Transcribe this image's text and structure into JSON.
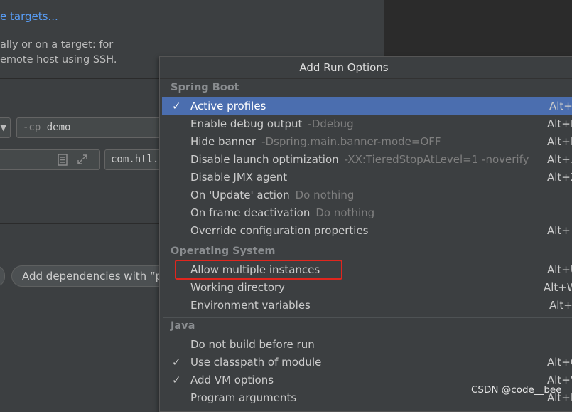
{
  "background": {
    "link_text": "e targets...",
    "description_line1": "ally or on a target: for",
    "description_line2": "emote host using SSH.",
    "cp_flag": "-cp",
    "cp_value": "demo",
    "main_class_value": "com.htl.",
    "dependencies_button": "Add dependencies with “p"
  },
  "popup": {
    "title": "Add Run Options",
    "sections": [
      {
        "title": "Spring Boot",
        "items": [
          {
            "label": "Active profiles",
            "hint": "",
            "shortcut": "Alt+",
            "checked": true,
            "selected": true
          },
          {
            "label": "Enable debug output",
            "hint": "-Ddebug",
            "shortcut": "Alt+D",
            "checked": false
          },
          {
            "label": "Hide banner",
            "hint": "-Dspring.main.banner-mode=OFF",
            "shortcut": "Alt+H",
            "checked": false
          },
          {
            "label": "Disable launch optimization",
            "hint": "-XX:TieredStopAtLevel=1 -noverify",
            "shortcut": "Alt+...",
            "checked": false
          },
          {
            "label": "Disable JMX agent",
            "hint": "",
            "shortcut": "Alt+X",
            "checked": false
          },
          {
            "label": "On 'Update' action",
            "hint": "Do nothing",
            "shortcut": "",
            "checked": false
          },
          {
            "label": "On frame deactivation",
            "hint": "Do nothing",
            "shortcut": "",
            "checked": false
          },
          {
            "label": "Override configuration properties",
            "hint": "",
            "shortcut": "Alt+",
            "checked": false
          }
        ]
      },
      {
        "title": "Operating System",
        "items": [
          {
            "label": "Allow multiple instances",
            "hint": "",
            "shortcut": "Alt+U",
            "checked": false
          },
          {
            "label": "Working directory",
            "hint": "",
            "shortcut": "Alt+W",
            "checked": false
          },
          {
            "label": "Environment variables",
            "hint": "",
            "shortcut": "Alt+",
            "checked": false
          }
        ]
      },
      {
        "title": "Java",
        "items": [
          {
            "label": "Do not build before run",
            "hint": "",
            "shortcut": "",
            "checked": false
          },
          {
            "label": "Use classpath of module",
            "hint": "",
            "shortcut": "Alt+O",
            "checked": true
          },
          {
            "label": "Add VM options",
            "hint": "",
            "shortcut": "Alt+V",
            "checked": true
          },
          {
            "label": "Program arguments",
            "hint": "",
            "shortcut": "Alt+R",
            "checked": false
          }
        ]
      }
    ]
  },
  "watermark": "CSDN @code__bee",
  "colors": {
    "selection": "#4b6eaf",
    "highlight_box": "#e0261e",
    "link": "#589df6"
  }
}
